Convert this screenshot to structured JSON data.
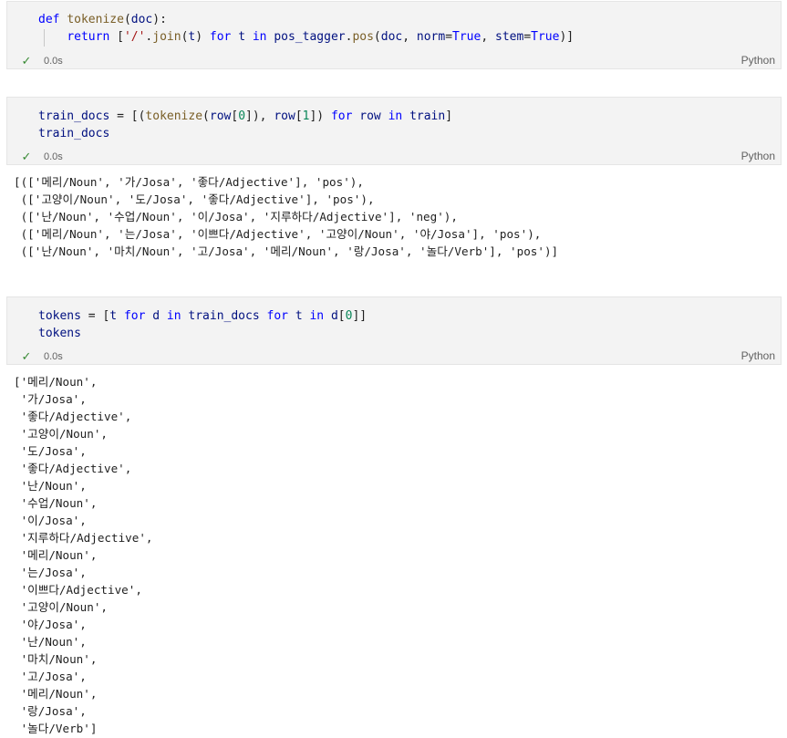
{
  "cells": [
    {
      "code_lines": [
        [
          {
            "t": "def",
            "c": "kw"
          },
          {
            "t": " ",
            "c": "pn"
          },
          {
            "t": "tokenize",
            "c": "fn"
          },
          {
            "t": "(",
            "c": "pn"
          },
          {
            "t": "doc",
            "c": "var"
          },
          {
            "t": "):",
            "c": "pn"
          }
        ],
        [
          {
            "t": "    ",
            "c": "pn"
          },
          {
            "t": "return",
            "c": "kw"
          },
          {
            "t": " [",
            "c": "pn"
          },
          {
            "t": "'/'",
            "c": "str"
          },
          {
            "t": ".",
            "c": "pn"
          },
          {
            "t": "join",
            "c": "fn"
          },
          {
            "t": "(",
            "c": "pn"
          },
          {
            "t": "t",
            "c": "var"
          },
          {
            "t": ") ",
            "c": "pn"
          },
          {
            "t": "for",
            "c": "kw"
          },
          {
            "t": " ",
            "c": "pn"
          },
          {
            "t": "t",
            "c": "var"
          },
          {
            "t": " ",
            "c": "pn"
          },
          {
            "t": "in",
            "c": "kw"
          },
          {
            "t": " ",
            "c": "pn"
          },
          {
            "t": "pos_tagger",
            "c": "var"
          },
          {
            "t": ".",
            "c": "pn"
          },
          {
            "t": "pos",
            "c": "fn"
          },
          {
            "t": "(",
            "c": "pn"
          },
          {
            "t": "doc",
            "c": "var"
          },
          {
            "t": ", ",
            "c": "pn"
          },
          {
            "t": "norm",
            "c": "var"
          },
          {
            "t": "=",
            "c": "pn"
          },
          {
            "t": "True",
            "c": "kw"
          },
          {
            "t": ", ",
            "c": "pn"
          },
          {
            "t": "stem",
            "c": "var"
          },
          {
            "t": "=",
            "c": "pn"
          },
          {
            "t": "True",
            "c": "kw"
          },
          {
            "t": ")]",
            "c": "pn"
          }
        ]
      ],
      "status": "0.0s",
      "language": "Python",
      "output": ""
    },
    {
      "code_lines": [
        [
          {
            "t": "train_docs",
            "c": "var"
          },
          {
            "t": " = [(",
            "c": "pn"
          },
          {
            "t": "tokenize",
            "c": "fn"
          },
          {
            "t": "(",
            "c": "pn"
          },
          {
            "t": "row",
            "c": "var"
          },
          {
            "t": "[",
            "c": "pn"
          },
          {
            "t": "0",
            "c": "num"
          },
          {
            "t": "]), ",
            "c": "pn"
          },
          {
            "t": "row",
            "c": "var"
          },
          {
            "t": "[",
            "c": "pn"
          },
          {
            "t": "1",
            "c": "num"
          },
          {
            "t": "]) ",
            "c": "pn"
          },
          {
            "t": "for",
            "c": "kw"
          },
          {
            "t": " ",
            "c": "pn"
          },
          {
            "t": "row",
            "c": "var"
          },
          {
            "t": " ",
            "c": "pn"
          },
          {
            "t": "in",
            "c": "kw"
          },
          {
            "t": " ",
            "c": "pn"
          },
          {
            "t": "train",
            "c": "var"
          },
          {
            "t": "]",
            "c": "pn"
          }
        ],
        [
          {
            "t": "train_docs",
            "c": "var"
          }
        ]
      ],
      "status": "0.0s",
      "language": "Python",
      "output": "[(['메리/Noun', '가/Josa', '좋다/Adjective'], 'pos'),\n (['고양이/Noun', '도/Josa', '좋다/Adjective'], 'pos'),\n (['난/Noun', '수업/Noun', '이/Josa', '지루하다/Adjective'], 'neg'),\n (['메리/Noun', '는/Josa', '이쁘다/Adjective', '고양이/Noun', '야/Josa'], 'pos'),\n (['난/Noun', '마치/Noun', '고/Josa', '메리/Noun', '랑/Josa', '놀다/Verb'], 'pos')]"
    },
    {
      "code_lines": [
        [
          {
            "t": "tokens",
            "c": "var"
          },
          {
            "t": " = [",
            "c": "pn"
          },
          {
            "t": "t",
            "c": "var"
          },
          {
            "t": " ",
            "c": "pn"
          },
          {
            "t": "for",
            "c": "kw"
          },
          {
            "t": " ",
            "c": "pn"
          },
          {
            "t": "d",
            "c": "var"
          },
          {
            "t": " ",
            "c": "pn"
          },
          {
            "t": "in",
            "c": "kw"
          },
          {
            "t": " ",
            "c": "pn"
          },
          {
            "t": "train_docs",
            "c": "var"
          },
          {
            "t": " ",
            "c": "pn"
          },
          {
            "t": "for",
            "c": "kw"
          },
          {
            "t": " ",
            "c": "pn"
          },
          {
            "t": "t",
            "c": "var"
          },
          {
            "t": " ",
            "c": "pn"
          },
          {
            "t": "in",
            "c": "kw"
          },
          {
            "t": " ",
            "c": "pn"
          },
          {
            "t": "d",
            "c": "var"
          },
          {
            "t": "[",
            "c": "pn"
          },
          {
            "t": "0",
            "c": "num"
          },
          {
            "t": "]]",
            "c": "pn"
          }
        ],
        [
          {
            "t": "tokens",
            "c": "var"
          }
        ]
      ],
      "status": "0.0s",
      "language": "Python",
      "output": "['메리/Noun',\n '가/Josa',\n '좋다/Adjective',\n '고양이/Noun',\n '도/Josa',\n '좋다/Adjective',\n '난/Noun',\n '수업/Noun',\n '이/Josa',\n '지루하다/Adjective',\n '메리/Noun',\n '는/Josa',\n '이쁘다/Adjective',\n '고양이/Noun',\n '야/Josa',\n '난/Noun',\n '마치/Noun',\n '고/Josa',\n '메리/Noun',\n '랑/Josa',\n '놀다/Verb']"
    }
  ],
  "icons": {
    "status": "check-icon"
  },
  "colors": {
    "keyword": "#0000ff",
    "function": "#795e26",
    "variable": "#001080",
    "string": "#a31515",
    "number": "#098658",
    "check": "#388a34",
    "cell_background": "#f3f3f3"
  }
}
